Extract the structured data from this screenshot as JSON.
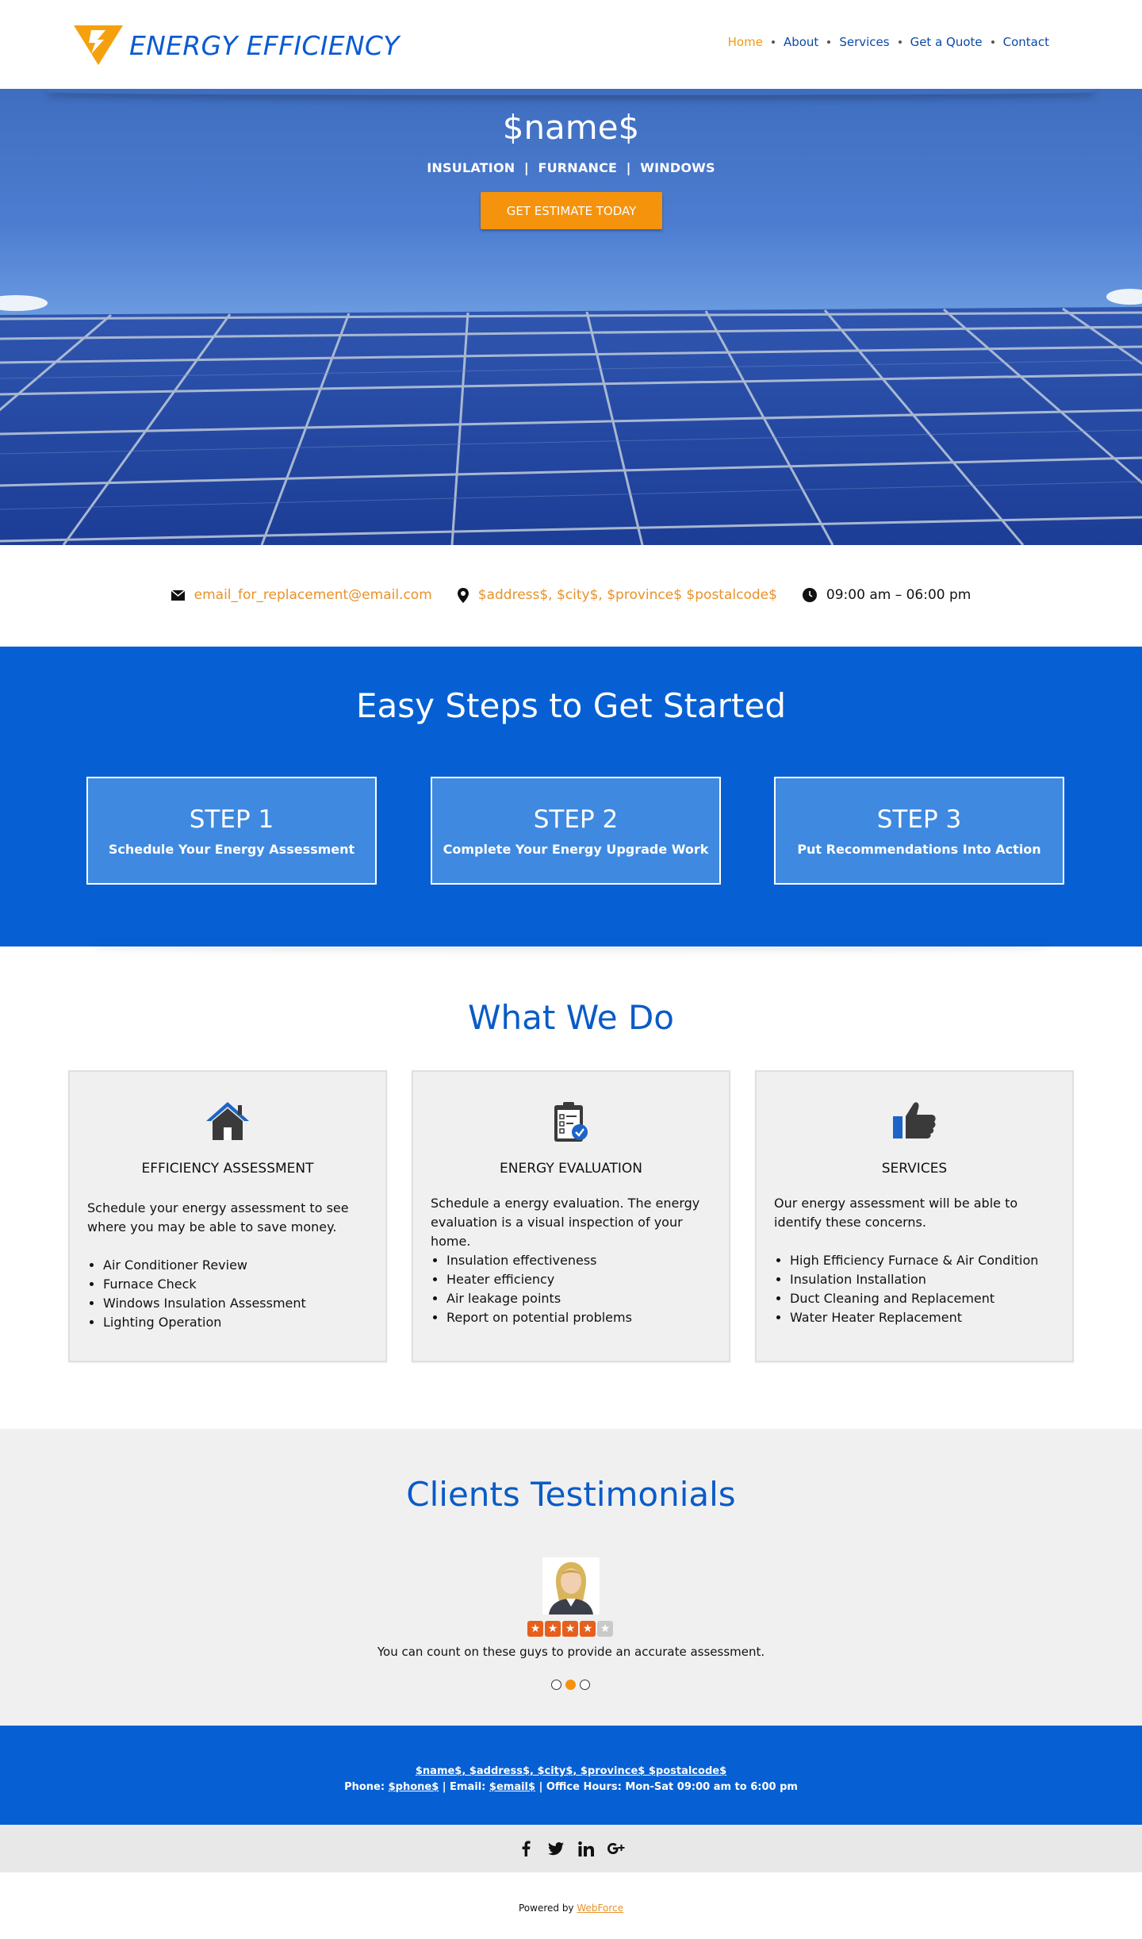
{
  "brand": {
    "name": "ENERGY EFFICIENCY",
    "color": "#0a5bd0",
    "accent": "#f5930c"
  },
  "nav": {
    "items": [
      {
        "label": "Home",
        "active": true
      },
      {
        "label": "About"
      },
      {
        "label": "Services"
      },
      {
        "label": "Get a Quote"
      },
      {
        "label": "Contact"
      }
    ]
  },
  "hero": {
    "title": "$name$",
    "subtitle": "INSULATION  |  FURNANCE  |  WINDOWS",
    "cta": "GET ESTIMATE TODAY"
  },
  "contact": {
    "email": "email_for_replacement@email.com",
    "address": "$address$, $city$, $province$ $postalcode$",
    "hours": "09:00 am – 06:00 pm"
  },
  "steps": {
    "title": "Easy Steps to Get Started",
    "items": [
      {
        "title": "STEP 1",
        "text": "Schedule Your Energy Assessment"
      },
      {
        "title": "STEP 2",
        "text": "Complete Your Energy Upgrade Work"
      },
      {
        "title": "STEP 3",
        "text": "Put Recommendations Into Action"
      }
    ]
  },
  "whatwedo": {
    "title": "What We Do",
    "cards": [
      {
        "icon": "house-icon",
        "title": "EFFICIENCY ASSESSMENT",
        "description": "Schedule your energy assessment to see where you may be able to save money.",
        "list": [
          "Air Conditioner Review",
          "Furnace Check",
          "Windows Insulation Assessment",
          "Lighting Operation"
        ]
      },
      {
        "icon": "clipboard-check-icon",
        "title": "ENERGY EVALUATION",
        "description": "Schedule a energy evaluation. The energy evaluation is a visual inspection of your home.",
        "list": [
          "Insulation effectiveness",
          "Heater efficiency",
          "Air leakage points",
          "Report on potential problems"
        ]
      },
      {
        "icon": "thumbs-up-icon",
        "title": "SERVICES",
        "description": "Our energy assessment will be able to identify these concerns.",
        "list": [
          "High Efficiency Furnace & Air Condition",
          "Insulation Installation",
          "Duct Cleaning and Replacement",
          "Water Heater Replacement"
        ]
      }
    ]
  },
  "testimonials": {
    "title": "Clients Testimonials",
    "rating": 4.5,
    "rating_max": 5,
    "quote": "You can count on these guys to provide an accurate assessment.",
    "slides": 3,
    "active_slide": 1
  },
  "footer": {
    "line1": "$name$, $address$, $city$, $province$ $postalcode$",
    "phone_label": "Phone:",
    "phone": "$phone$",
    "email_label": "| Email:",
    "email": "$email$",
    "hours": "| Office Hours: Mon-Sat 09:00 am to 6:00 pm"
  },
  "social": [
    "facebook-icon",
    "twitter-icon",
    "linkedin-icon",
    "google-plus-icon"
  ],
  "powered": {
    "prefix": "Powered by",
    "brand": "WebForce"
  }
}
